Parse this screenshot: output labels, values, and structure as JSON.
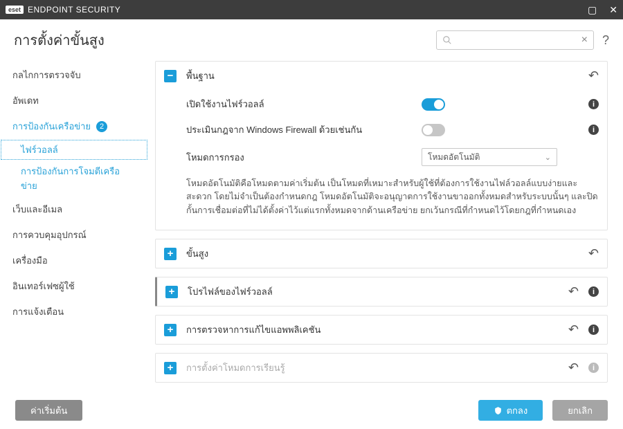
{
  "titlebar": {
    "brand": "eset",
    "title": "ENDPOINT SECURITY"
  },
  "header": {
    "title": "การตั้งค่าขั้นสูง"
  },
  "search": {
    "placeholder": ""
  },
  "sidebar": {
    "items": [
      {
        "label": "กลไกการตรวจจับ"
      },
      {
        "label": "อัพเดท"
      },
      {
        "label": "การป้องกันเครือข่าย",
        "badge": "2",
        "active": true,
        "children": [
          {
            "label": "ไฟร์วอลล์",
            "selected": true
          },
          {
            "label": "การป้องกันการโจมตีเครือข่าย"
          }
        ]
      },
      {
        "label": "เว็บและอีเมล"
      },
      {
        "label": "การควบคุมอุปกรณ์"
      },
      {
        "label": "เครื่องมือ"
      },
      {
        "label": "อินเทอร์เฟซผู้ใช้"
      },
      {
        "label": "การแจ้งเตือน"
      }
    ]
  },
  "panels": {
    "basic": {
      "title": "พื้นฐาน",
      "row_enable": "เปิดใช้งานไฟร์วอลล์",
      "row_windows": "ประเมินกฎจาก Windows Firewall ด้วยเช่นกัน",
      "row_mode": "โหมดการกรอง",
      "mode_value": "โหมดอัตโนมัติ",
      "description": "โหมดอัตโนมัติคือโหมดตามค่าเริ่มต้น เป็นโหมดที่เหมาะสำหรับผู้ใช้ที่ต้องการใช้งานไฟล์วอลล์แบบง่ายและสะดวก โดยไม่จำเป็นต้องกำหนดกฎ โหมดอัตโนมัติจะอนุญาตการใช้งานขาออกทั้งหมดสำหรับระบบนั้นๆ และปิดกั้นการเชื่อมต่อที่ไม่ได้ตั้งค่าไว้แต่แรกทั้งหมดจากด้านเครือข่าย ยกเว้นกรณีที่กำหนดไว้โดยกฎที่กำหนดเอง"
    },
    "advanced": {
      "title": "ขั้นสูง"
    },
    "profiles": {
      "title": "โปรไฟล์ของไฟร์วอลล์"
    },
    "appmod": {
      "title": "การตรวจหาการแก้ไขแอพพลิเคชัน"
    },
    "learning": {
      "title": "การตั้งค่าโหมดการเรียนรู้"
    }
  },
  "footer": {
    "defaults": "ค่าเริ่มต้น",
    "ok": "ตกลง",
    "cancel": "ยกเลิก"
  }
}
